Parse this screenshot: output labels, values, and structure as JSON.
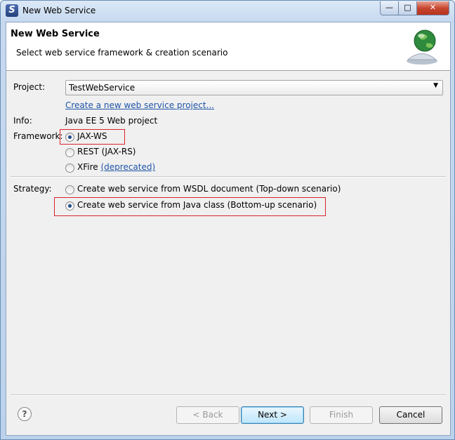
{
  "window": {
    "title": "New Web Service",
    "app_icon_glyph": "S",
    "minimize_glyph": "—",
    "maximize_glyph": "□",
    "close_glyph": "✕"
  },
  "banner": {
    "title": "New Web Service",
    "description": "Select web service framework & creation scenario",
    "image_icon": "globe-service-icon"
  },
  "form": {
    "project_label": "Project:",
    "project_value": "TestWebService",
    "create_project_link": "Create a new web service project...",
    "info_label": "Info:",
    "info_value": "Java EE 5 Web project",
    "framework_label": "Framework:",
    "framework_options": [
      {
        "label": "JAX-WS",
        "checked": true
      },
      {
        "label": "REST (JAX-RS)",
        "checked": false
      },
      {
        "label": "XFire",
        "checked": false,
        "link": "(deprecated)"
      }
    ],
    "strategy_label": "Strategy:",
    "strategy_options": [
      {
        "label": "Create web service from WSDL document (Top-down scenario)",
        "checked": false
      },
      {
        "label": "Create web service from Java class (Bottom-up scenario)",
        "checked": true
      }
    ]
  },
  "buttons": {
    "help_glyph": "?",
    "back": "< Back",
    "next": "Next >",
    "finish": "Finish",
    "cancel": "Cancel"
  },
  "colors": {
    "highlight": "#d9232a",
    "link": "#1f55a8"
  }
}
